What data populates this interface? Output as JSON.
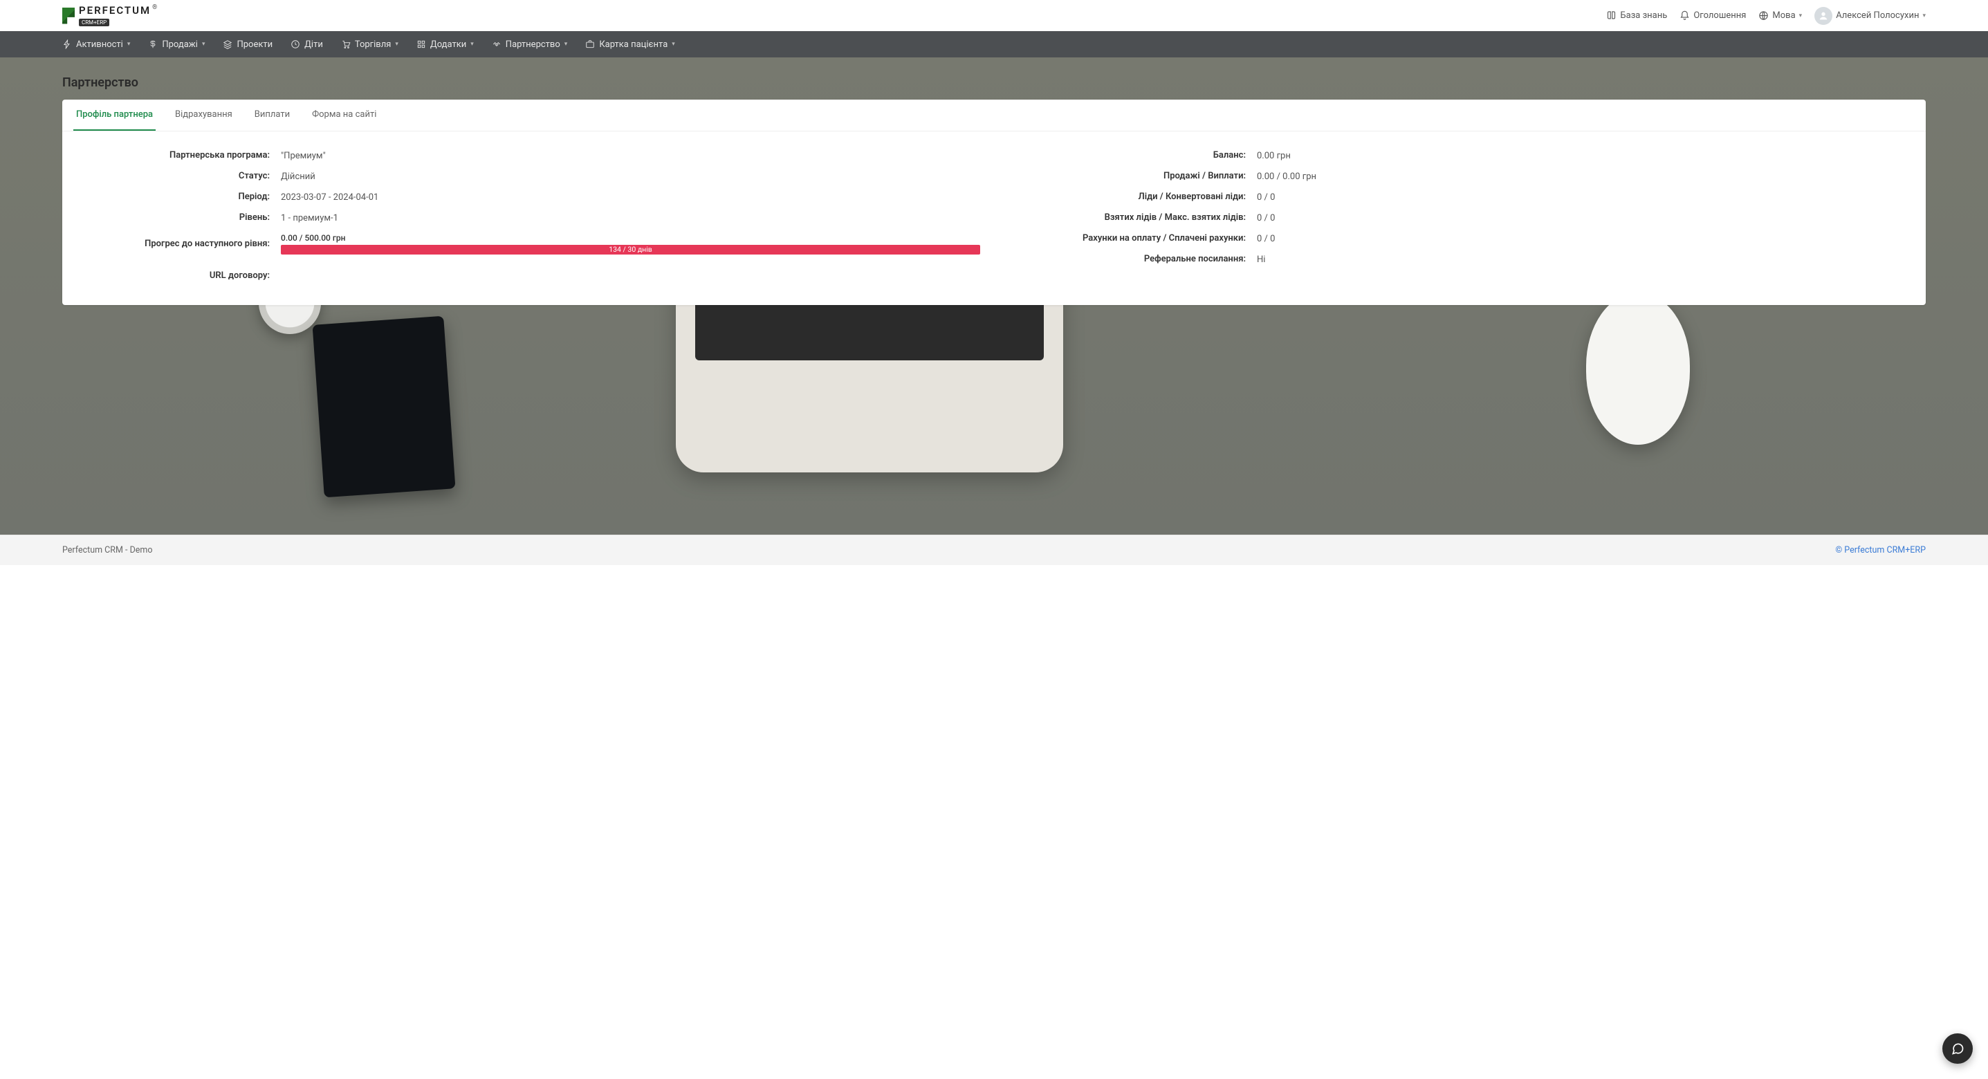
{
  "header": {
    "logo_text": "PERFECTUM",
    "logo_sub": "CRM+ERP",
    "logo_reg": "®",
    "kb": "База знань",
    "announcements": "Оголошення",
    "language": "Мова",
    "user_name": "Алексей Полосухин"
  },
  "nav": {
    "items": [
      {
        "label": "Активності",
        "caret": true,
        "icon": "bolt"
      },
      {
        "label": "Продажі",
        "caret": true,
        "icon": "dollar"
      },
      {
        "label": "Проекти",
        "caret": false,
        "icon": "layers"
      },
      {
        "label": "Діти",
        "caret": false,
        "icon": "clock"
      },
      {
        "label": "Торгівля",
        "caret": true,
        "icon": "cart"
      },
      {
        "label": "Додатки",
        "caret": true,
        "icon": "grid"
      },
      {
        "label": "Партнерство",
        "caret": true,
        "icon": "handshake"
      },
      {
        "label": "Картка пацієнта",
        "caret": true,
        "icon": "briefcase"
      }
    ]
  },
  "page": {
    "title": "Партнерство"
  },
  "tabs": [
    {
      "label": "Профіль партнера",
      "active": true
    },
    {
      "label": "Відрахування",
      "active": false
    },
    {
      "label": "Виплати",
      "active": false
    },
    {
      "label": "Форма на сайті",
      "active": false
    }
  ],
  "profile": {
    "left": {
      "program_label": "Партнерська програма:",
      "program_value": "\"Премиум\"",
      "status_label": "Статус:",
      "status_value": "Дійсний",
      "period_label": "Період:",
      "period_value": "2023-03-07 - 2024-04-01",
      "level_label": "Рівень:",
      "level_value": "1 - премиум-1",
      "progress_label": "Прогрес до наступного рівня:",
      "progress_top": "0.00 / 500.00 грн",
      "progress_days": "134 / 30 днів",
      "url_label": "URL договору:",
      "url_value": ""
    },
    "right": {
      "balance_label": "Баланс:",
      "balance_value": "0.00 грн",
      "sales_label": "Продажі / Виплати:",
      "sales_value": "0.00 / 0.00 грн",
      "leads_label": "Ліди / Конвертовані ліди:",
      "leads_value": "0 / 0",
      "taken_label": "Взятих лідів / Макс. взятих лідів:",
      "taken_value": "0 / 0",
      "invoices_label": "Рахунки на оплату / Сплачені рахунки:",
      "invoices_value": "0 / 0",
      "ref_label": "Реферальне посилання:",
      "ref_value": "Ні"
    }
  },
  "footer": {
    "left": "Perfectum CRM - Demo",
    "right": "© Perfectum CRM+ERP"
  }
}
